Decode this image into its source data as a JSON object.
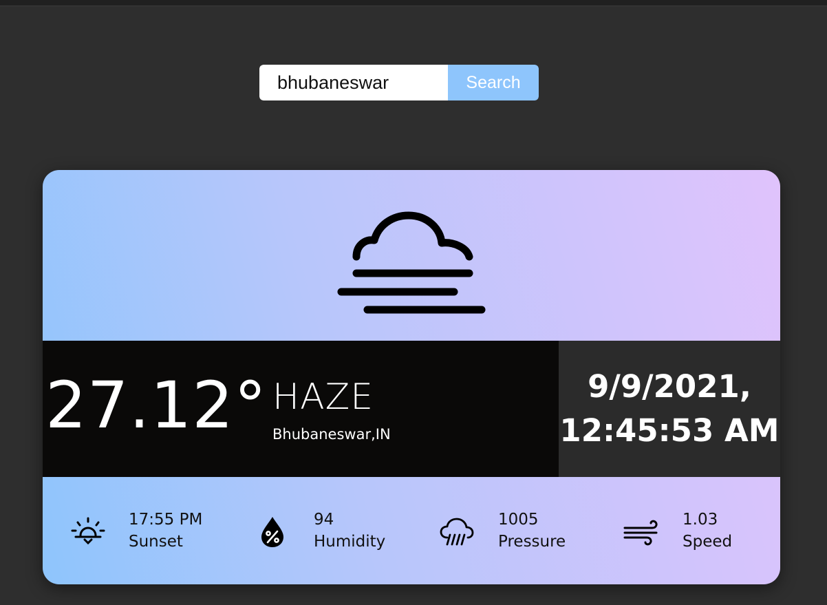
{
  "search": {
    "value": "bhubaneswar",
    "button_label": "Search"
  },
  "weather": {
    "icon": "haze-icon",
    "temperature": "27.12°",
    "condition": "HAZE",
    "location": "Bhubaneswar,IN",
    "date": "9/9/2021,",
    "time": "12:45:53 AM"
  },
  "stats": [
    {
      "icon": "sunset-icon",
      "value": "17:55 PM",
      "label": "Sunset"
    },
    {
      "icon": "humidity-icon",
      "value": "94",
      "label": "Humidity"
    },
    {
      "icon": "pressure-icon",
      "value": "1005",
      "label": "Pressure"
    },
    {
      "icon": "wind-icon",
      "value": "1.03",
      "label": "Speed"
    }
  ],
  "colors": {
    "page_background": "#2e2e2e",
    "search_button": "#8ec5fc",
    "gradient_start": "#8ec5fc",
    "gradient_end": "#e0c3fc",
    "temp_panel": "#0a0908",
    "date_panel": "#2b2b2b"
  }
}
